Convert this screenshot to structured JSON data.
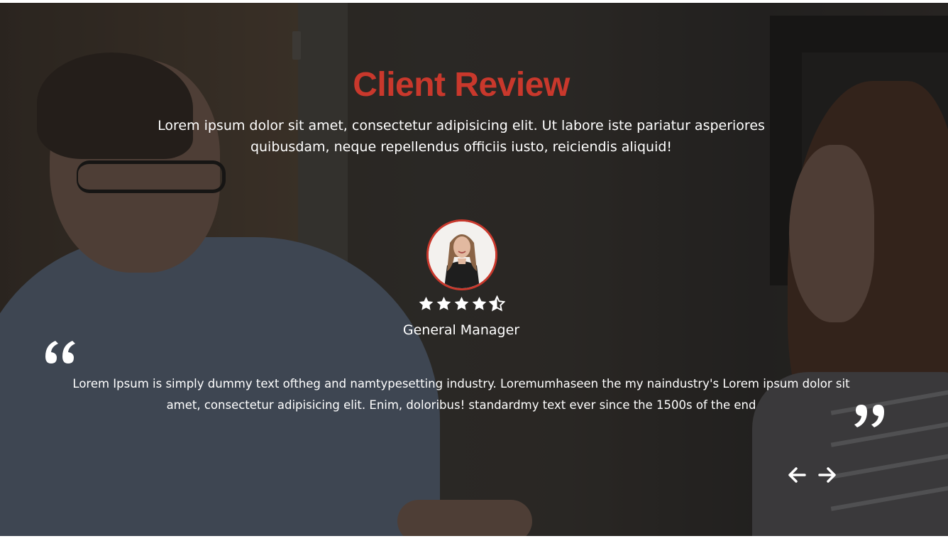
{
  "section": {
    "title": "Client Review",
    "subtitle": "Lorem ipsum dolor sit amet, consectetur adipisicing elit. Ut labore iste pariatur asperiores quibusdam, neque repellendus officiis iusto, reiciendis aliquid!"
  },
  "testimonial": {
    "rating": 4.5,
    "rating_max": 5,
    "role": "General Manager",
    "text": "Lorem Ipsum is simply dummy text oftheg and namtypesetting industry. Loremumhaseen the my naindustry's Lorem ipsum dolor sit amet, consectetur adipisicing elit. Enim, doloribus! standardmy text ever since the 1500s of the end"
  },
  "icons": {
    "quote_open": "quote-open-icon",
    "quote_close": "quote-close-icon",
    "prev": "arrow-left-icon",
    "next": "arrow-right-icon",
    "star": "star-icon"
  },
  "colors": {
    "accent": "#c9382c",
    "text": "#ffffff"
  }
}
